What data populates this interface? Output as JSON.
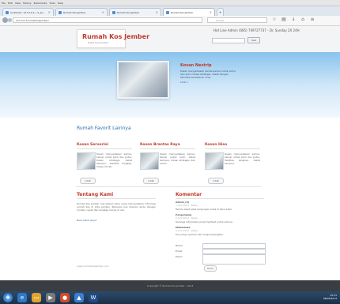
{
  "browser": {
    "menu": [
      "File",
      "Edit",
      "View",
      "History",
      "Bookmarks",
      "Tools",
      "Help"
    ],
    "tabs": [
      {
        "label": "localhost / 127.0.0.1 / rs_ko...",
        "active": false
      },
      {
        "label": "Rumah Kos Jember",
        "active": false
      },
      {
        "label": "Rumah Kos Jember",
        "active": false
      },
      {
        "label": "Rumah Kos Jember",
        "active": true
      }
    ],
    "url": "127.0.0.1/rumahkosjember/",
    "search_placeholder": "Google"
  },
  "site": {
    "logo_title": "Rumah Kos Jember",
    "logo_sub": "Pusat Kos Jember",
    "contact": "Hot Line Admin (085) 749727737 - Dr. Sunday 2X 24H",
    "search_label": "Cari",
    "hero": {
      "title": "Kosan Nestrip",
      "desc": "Kosan menyediakan kamar-kamar untuk putra dan putri, lokasi strategis, dekat dengan Fakultas Kedokteran Unej.",
      "link": "Lihat »"
    },
    "favorites_title": "Rumah Favorit Lainnya",
    "cards": [
      {
        "title": "Kosan Servorini",
        "text": "Kosan menyediakan kamar-kamar untuk putri dan putra. Kosan strategis dekat kampus, fasilitas lengkap, harga murah.",
        "btn": "Lihat"
      },
      {
        "title": "Kosan Brantas Raya",
        "text": "Kosan menyediakan kamar-kamar untuk putri, dekat kampus, lokasi strategis dan aman.",
        "btn": "Lihat"
      },
      {
        "title": "Kosan Hiso",
        "text": "Kosan menyediakan kamar-kamar untuk putri dan putra. Fasilitas lengkap, dekat kampus.",
        "btn": "Lihat"
      }
    ],
    "about": {
      "title": "Tentang Kami",
      "text": "Rumah Kos Jember merupakan situs yang menyediakan informasi rumah kos di kota Jember. Temukan kos idaman anda dengan mudah, cepat dan lengkap hanya di sini.",
      "link": "Baca lebih lanjut",
      "foot": "www.rumahkosjember.com"
    },
    "comments": {
      "title": "Komentar",
      "items": [
        {
          "name": "Admin_rkj",
          "meta": "1 Juni 2013 · Reply",
          "text": "Terima kasih atas kunjungan anda di situs kami."
        },
        {
          "name": "Pengunjung",
          "meta": "2 Juni 2013 · Reply",
          "text": "Semoga informasinya bermanfaat untuk semua."
        },
        {
          "name": "Mahasiswa",
          "meta": "3 Juni 2013 · Reply",
          "text": "Kos yang nyaman dan harga terjangkau."
        }
      ],
      "form_name": "Nama",
      "form_email": "Email",
      "form_msg": "Pesan",
      "submit": "Kirim"
    },
    "footer": "Copyright © Rumah Kos Jember - 2013"
  },
  "taskbar": {
    "time": "15:31",
    "date": "08/06/2013"
  }
}
